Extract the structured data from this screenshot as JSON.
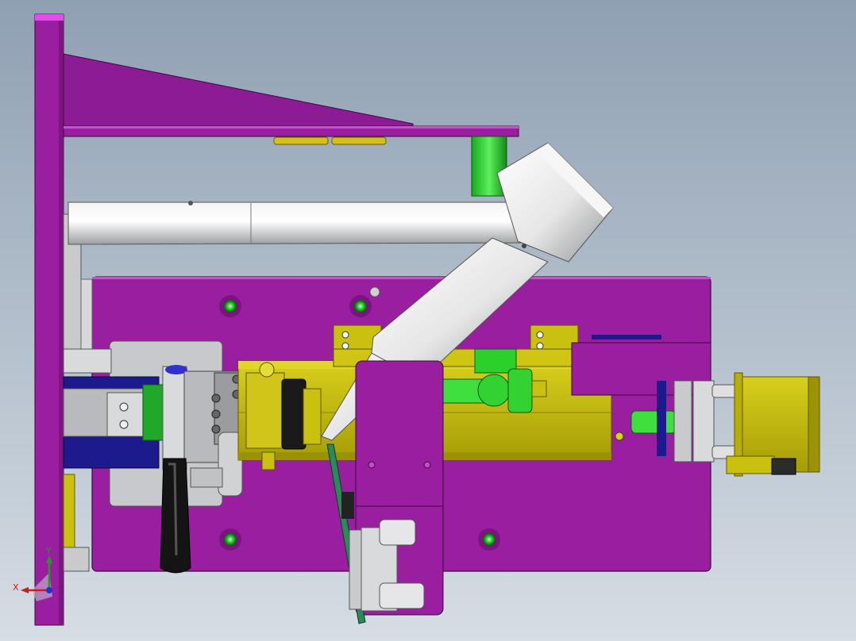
{
  "view": {
    "background_top": "#8fa0b3",
    "background_bottom": "#d6dde4"
  },
  "colors": {
    "frame_purple": "#9a1fa0",
    "frame_purple_dark": "#7d1683",
    "plate_purple": "#8e1b96",
    "brass": "#c9c00f",
    "brass_dark": "#8c8400",
    "silver": "#d9dadc",
    "silver_dark": "#8e9093",
    "green": "#2bd02b",
    "green_dark": "#0f8a12",
    "navy": "#1c1a8c",
    "black": "#141414"
  },
  "triad": {
    "x_label": "X",
    "y_label": "Y",
    "x_color": "#d11a1a",
    "y_color": "#1aa01a",
    "z_color": "#1a36d1"
  }
}
